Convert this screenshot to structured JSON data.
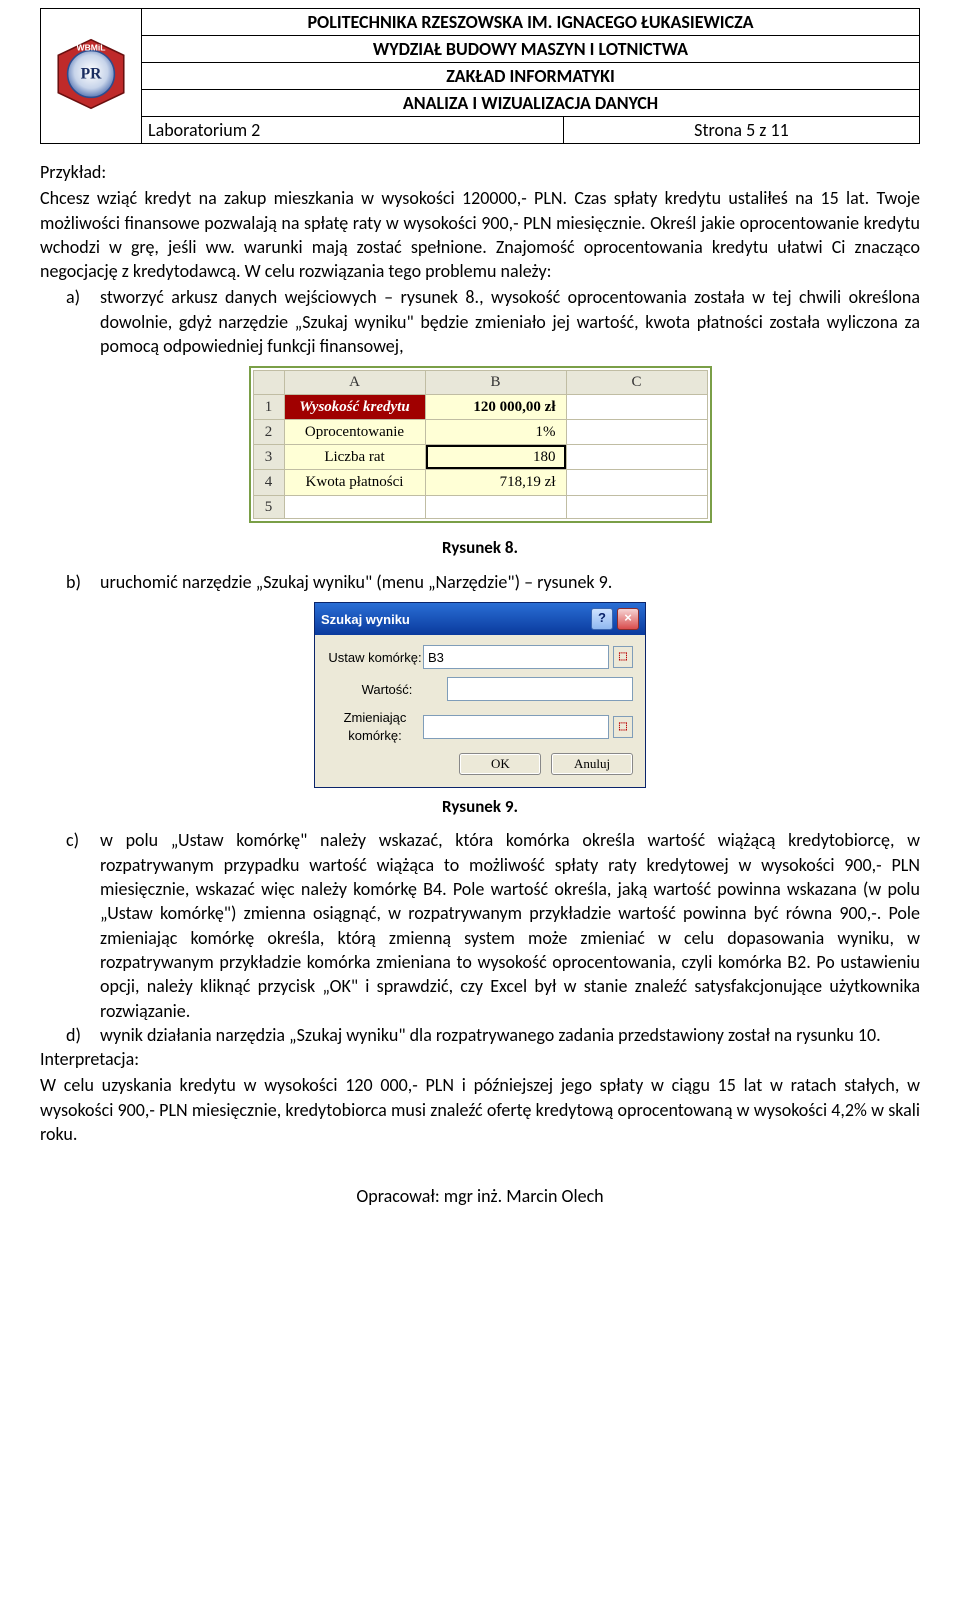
{
  "header": {
    "line1": "POLITECHNIKA RZESZOWSKA IM. IGNACEGO ŁUKASIEWICZA",
    "line2": "WYDZIAŁ BUDOWY MASZYN I LOTNICTWA",
    "line3": "ZAKŁAD INFORMATYKI",
    "line4": "ANALIZA I WIZUALIZACJA DANYCH",
    "left": "Laboratorium 2",
    "right": "Strona 5 z 11",
    "logo_text": "WBMiL"
  },
  "content": {
    "p_przyklad": "Przykład:",
    "p_intro1": "Chcesz wziąć kredyt na zakup mieszkania w wysokości 120000,- PLN. Czas spłaty kredytu ustaliłeś na 15 lat. Twoje możliwości finansowe pozwalają na spłatę raty w wysokości 900,- PLN miesięcznie. Określ jakie oprocentowanie kredytu wchodzi w grę, jeśli ww. warunki mają zostać spełnione. Znajomość oprocentowania kredytu ułatwi Ci znacząco negocjację z kredytodawcą. W celu rozwiązania tego problemu należy:",
    "a_marker": "a)",
    "a_text": "stworzyć arkusz danych wejściowych – rysunek 8., wysokość oprocentowania została w tej chwili określona dowolnie, gdyż narzędzie „Szukaj wyniku\" będzie zmieniało jej wartość, kwota płatności została wyliczona za pomocą odpowiedniej funkcji finansowej,",
    "caption8": "Rysunek 8.",
    "b_marker": "b)",
    "b_text": "uruchomić narzędzie „Szukaj wyniku\" (menu „Narzędzie\") – rysunek 9.",
    "caption9": "Rysunek 9.",
    "c_marker": "c)",
    "c_text": "w polu „Ustaw komórkę\" należy wskazać, która komórka określa wartość wiążącą kredytobiorcę, w rozpatrywanym przypadku wartość wiążąca to możliwość spłaty raty kredytowej w wysokości 900,- PLN miesięcznie, wskazać więc należy komórkę B4. Pole wartość określa, jaką wartość powinna wskazana (w polu „Ustaw komórkę\") zmienna osiągnąć, w rozpatrywanym przykładzie wartość powinna być równa 900,-. Pole zmieniając komórkę określa, którą zmienną system może zmieniać w celu dopasowania wyniku, w rozpatrywanym przykładzie komórka zmieniana to wysokość oprocentowania, czyli komórka B2. Po ustawieniu opcji, należy kliknąć przycisk „OK\" i sprawdzić, czy Excel był w stanie znaleźć satysfakcjonujące użytkownika rozwiązanie.",
    "d_marker": "d)",
    "d_text": "wynik działania narzędzia „Szukaj wyniku\" dla rozpatrywanego zadania przedstawiony został na rysunku 10.",
    "interpretacja_label": "Interpretacja:",
    "interpretacja_text": "W celu uzyskania kredytu w wysokości 120 000,- PLN i późniejszej jego spłaty w ciągu 15 lat w ratach stałych, w wysokości 900,- PLN miesięcznie, kredytobiorca musi znaleźć ofertę kredytową oprocentowaną w wysokości 4,2% w skali roku."
  },
  "sheet": {
    "colA": "A",
    "colB": "B",
    "colC": "C",
    "rows": [
      {
        "n": "1",
        "a": "Wysokość kredytu",
        "b": "120 000,00 zł"
      },
      {
        "n": "2",
        "a": "Oprocentowanie",
        "b": "1%"
      },
      {
        "n": "3",
        "a": "Liczba rat",
        "b": "180"
      },
      {
        "n": "4",
        "a": "Kwota płatności",
        "b": "718,19 zł"
      },
      {
        "n": "5",
        "a": "",
        "b": ""
      }
    ]
  },
  "dialog": {
    "title": "Szukaj wyniku",
    "label1": "Ustaw komórkę:",
    "value1": "B3",
    "label2": "Wartość:",
    "value2": "",
    "label3": "Zmieniając komórkę:",
    "value3": "",
    "ok": "OK",
    "cancel": "Anuluj"
  },
  "footer": "Opracował: mgr inż. Marcin Olech"
}
